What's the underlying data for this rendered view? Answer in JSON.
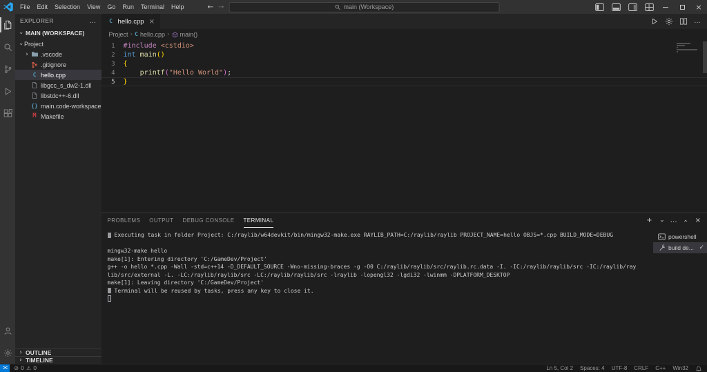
{
  "titlebar": {
    "menus": [
      "File",
      "Edit",
      "Selection",
      "View",
      "Go",
      "Run",
      "Terminal",
      "Help"
    ],
    "search_placeholder": "main (Workspace)"
  },
  "activitybar": {
    "top": [
      "explorer",
      "search",
      "source-control",
      "run-and-debug",
      "extensions"
    ],
    "active": "explorer",
    "bottom": [
      "account",
      "settings"
    ]
  },
  "sidebar": {
    "title": "EXPLORER",
    "workspace_label": "MAIN (WORKSPACE)",
    "tree": [
      {
        "label": "Project",
        "chevron": "expanded",
        "level": 0
      },
      {
        "label": ".vscode",
        "icon": "folder",
        "chevron": "collapsed",
        "level": 1
      },
      {
        "label": ".gitignore",
        "icon": "git",
        "level": 1
      },
      {
        "label": "hello.cpp",
        "icon": "cpp",
        "level": 1,
        "selected": true
      },
      {
        "label": "libgcc_s_dw2-1.dll",
        "icon": "file",
        "level": 1
      },
      {
        "label": "libstdc++-6.dll",
        "icon": "file",
        "level": 1
      },
      {
        "label": "main.code-workspace",
        "icon": "braces",
        "level": 1
      },
      {
        "label": "Makefile",
        "icon": "makefile",
        "level": 1
      }
    ],
    "bottom_sections": [
      "OUTLINE",
      "TIMELINE"
    ]
  },
  "editor": {
    "tabs": [
      {
        "label": "hello.cpp",
        "active": true
      }
    ],
    "actions": [
      {
        "name": "run-button",
        "icon": "run"
      },
      {
        "name": "settings-gear-icon",
        "icon": "gear"
      },
      {
        "name": "split-editor-icon",
        "icon": "split"
      },
      {
        "name": "more-actions-icon",
        "glyph": "…"
      }
    ],
    "breadcrumb": [
      {
        "label": "Project"
      },
      {
        "label": "hello.cpp",
        "icon": "cpp"
      },
      {
        "label": "main()",
        "icon": "method"
      }
    ],
    "code": [
      {
        "num": "1",
        "tokens": [
          [
            "#include",
            "pp"
          ],
          [
            " ",
            ""
          ],
          [
            "<cstdio>",
            "str"
          ]
        ]
      },
      {
        "num": "2",
        "tokens": [
          [
            "int",
            "kw"
          ],
          [
            " ",
            ""
          ],
          [
            "main",
            "fn"
          ],
          [
            "()",
            "b1"
          ]
        ]
      },
      {
        "num": "3",
        "tokens": [
          [
            "{",
            "b1"
          ]
        ]
      },
      {
        "num": "4",
        "tokens": [
          [
            "    ",
            ""
          ],
          [
            "printf",
            "fn"
          ],
          [
            "(",
            "b2"
          ],
          [
            "\"Hello World\"",
            "str"
          ],
          [
            ")",
            "b2"
          ],
          [
            ";",
            "pl"
          ]
        ]
      },
      {
        "num": "5",
        "tokens": [
          [
            "}",
            "b1"
          ]
        ],
        "current": true
      }
    ]
  },
  "panel": {
    "tabs": [
      {
        "label": "PROBLEMS"
      },
      {
        "label": "OUTPUT"
      },
      {
        "label": "DEBUG CONSOLE"
      },
      {
        "label": "TERMINAL",
        "active": true
      }
    ],
    "actions": [
      {
        "name": "new-terminal-icon",
        "glyph": "+"
      },
      {
        "name": "launch-profile-dropdown-icon",
        "glyph": "›",
        "rotate": "down"
      },
      {
        "name": "more-actions-icon",
        "glyph": "…"
      },
      {
        "name": "maximize-panel-icon",
        "glyph": "›",
        "rotate": "up"
      },
      {
        "name": "close-panel-icon",
        "glyph": "×"
      }
    ],
    "terminal_lines": [
      {
        "marker": true,
        "text": "Executing task in folder Project: C:/raylib/w64devkit/bin/mingw32-make.exe RAYLIB_PATH=C:/raylib/raylib PROJECT_NAME=hello OBJS=*.cpp BUILD_MODE=DEBUG "
      },
      {
        "text": ""
      },
      {
        "text": "mingw32-make hello"
      },
      {
        "text": "make[1]: Entering directory 'C:/GameDev/Project'"
      },
      {
        "text": "g++ -o hello *.cpp -Wall -std=c++14 -D_DEFAULT_SOURCE -Wno-missing-braces -g -O0 C:/raylib/raylib/src/raylib.rc.data -I. -IC:/raylib/raylib/src -IC:/raylib/ray"
      },
      {
        "text": "lib/src/external -L. -LC:/raylib/raylib/src -LC:/raylib/raylib/src -lraylib -lopengl32 -lgdi32 -lwinmm -DPLATFORM_DESKTOP"
      },
      {
        "text": "make[1]: Leaving directory 'C:/GameDev/Project'"
      },
      {
        "marker": true,
        "text": "Terminal will be reused by tasks, press any key to close it. "
      },
      {
        "cursor": true,
        "text": ""
      }
    ],
    "terminals": [
      {
        "label": "powershell",
        "icon": "terminal"
      },
      {
        "label": "build de...",
        "icon": "tools",
        "selected": true,
        "checked": true
      }
    ]
  },
  "statusbar": {
    "remote_glyph": "><",
    "errors": "0",
    "warnings": "0",
    "right": [
      "Ln 5, Col 2",
      "Spaces: 4",
      "UTF-8",
      "CRLF",
      "C++",
      "Win32"
    ]
  }
}
